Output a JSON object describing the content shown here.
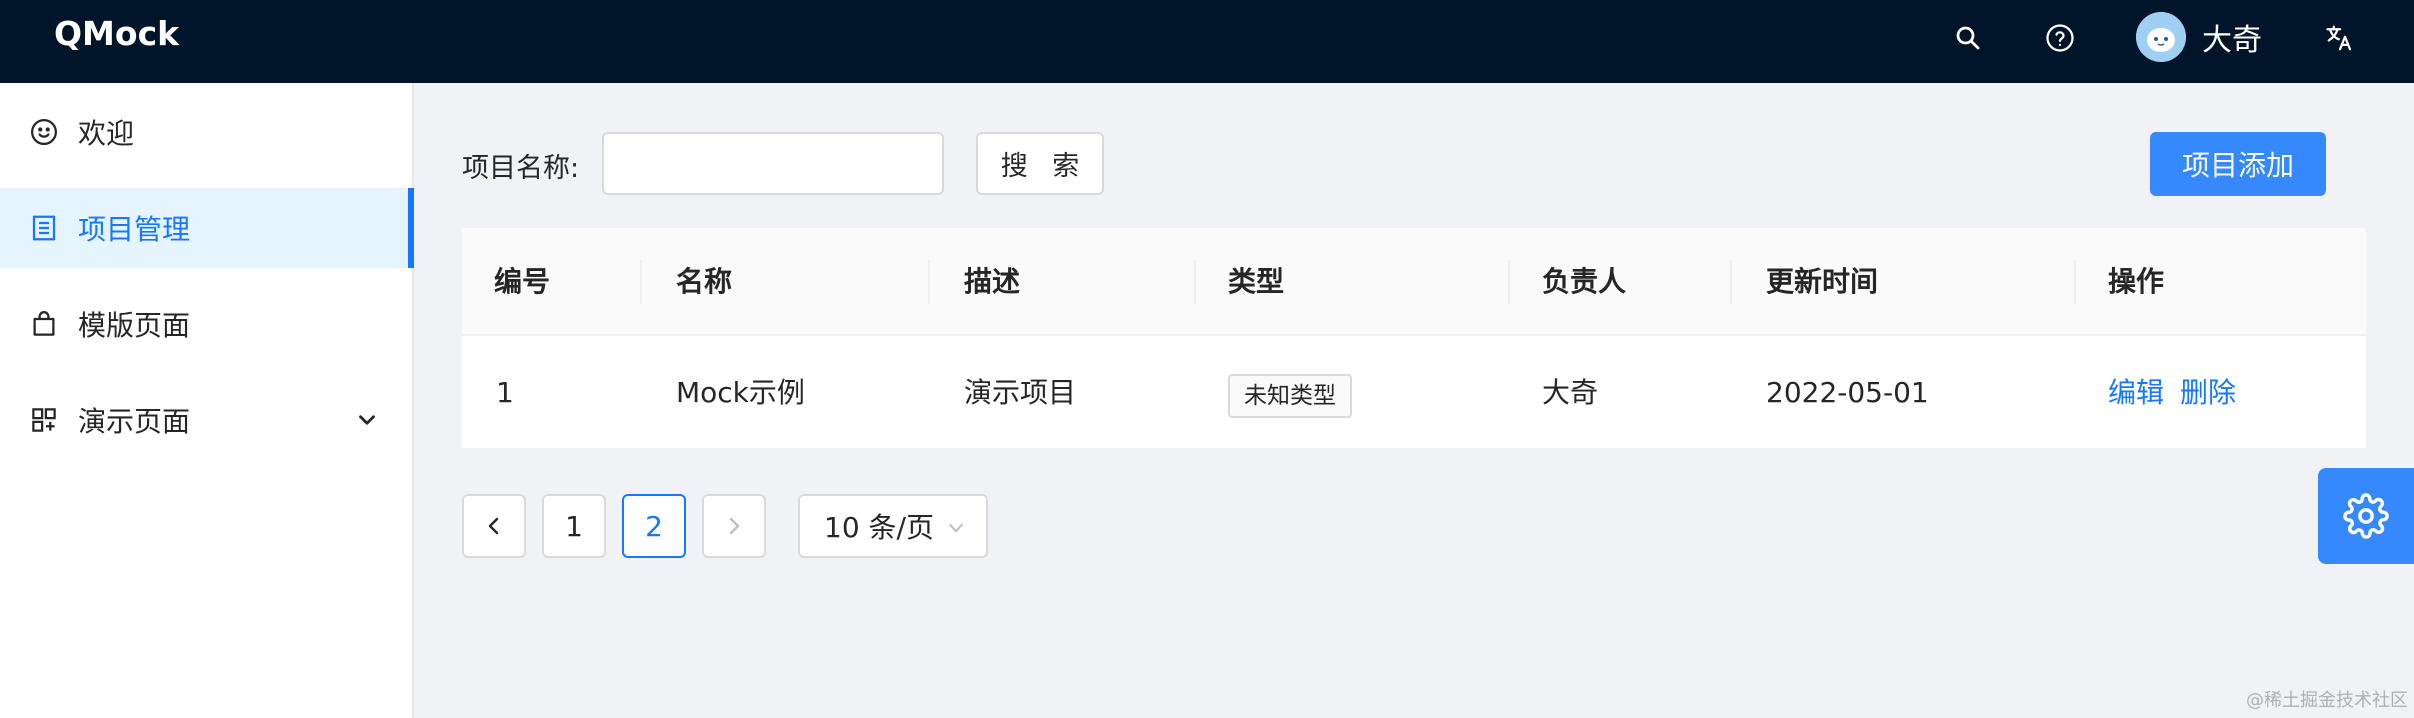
{
  "header": {
    "app_title": "QMock",
    "user_name": "大奇",
    "icons": [
      "search-icon",
      "help-icon",
      "translate-icon"
    ]
  },
  "sidebar": {
    "items": [
      {
        "label": "欢迎",
        "icon": "smile-icon",
        "active": false
      },
      {
        "label": "项目管理",
        "icon": "table-icon",
        "active": true
      },
      {
        "label": "模版页面",
        "icon": "shopping-icon",
        "active": false
      },
      {
        "label": "演示页面",
        "icon": "appstore-add-icon",
        "active": false,
        "expandable": true
      }
    ]
  },
  "search": {
    "label": "项目名称:",
    "value": "",
    "placeholder": "",
    "button_label": "搜 索"
  },
  "add_button_label": "项目添加",
  "table": {
    "columns": [
      "编号",
      "名称",
      "描述",
      "类型",
      "负责人",
      "更新时间",
      "操作"
    ],
    "rows": [
      {
        "id": "1",
        "name": "Mock示例",
        "description": "演示项目",
        "type": "未知类型",
        "owner": "大奇",
        "updated": "2022-05-01",
        "actions": [
          "编辑",
          "删除"
        ]
      }
    ]
  },
  "pagination": {
    "pages": [
      "1",
      "2"
    ],
    "current_page": "2",
    "page_size": "10 条/页"
  },
  "watermark": "@稀土掘金技术社区",
  "colors": {
    "header_bg": "#001529",
    "accent": "#1677ff",
    "page_bg": "#f0f2f5",
    "active_menu_bg": "#e6f4ff"
  }
}
